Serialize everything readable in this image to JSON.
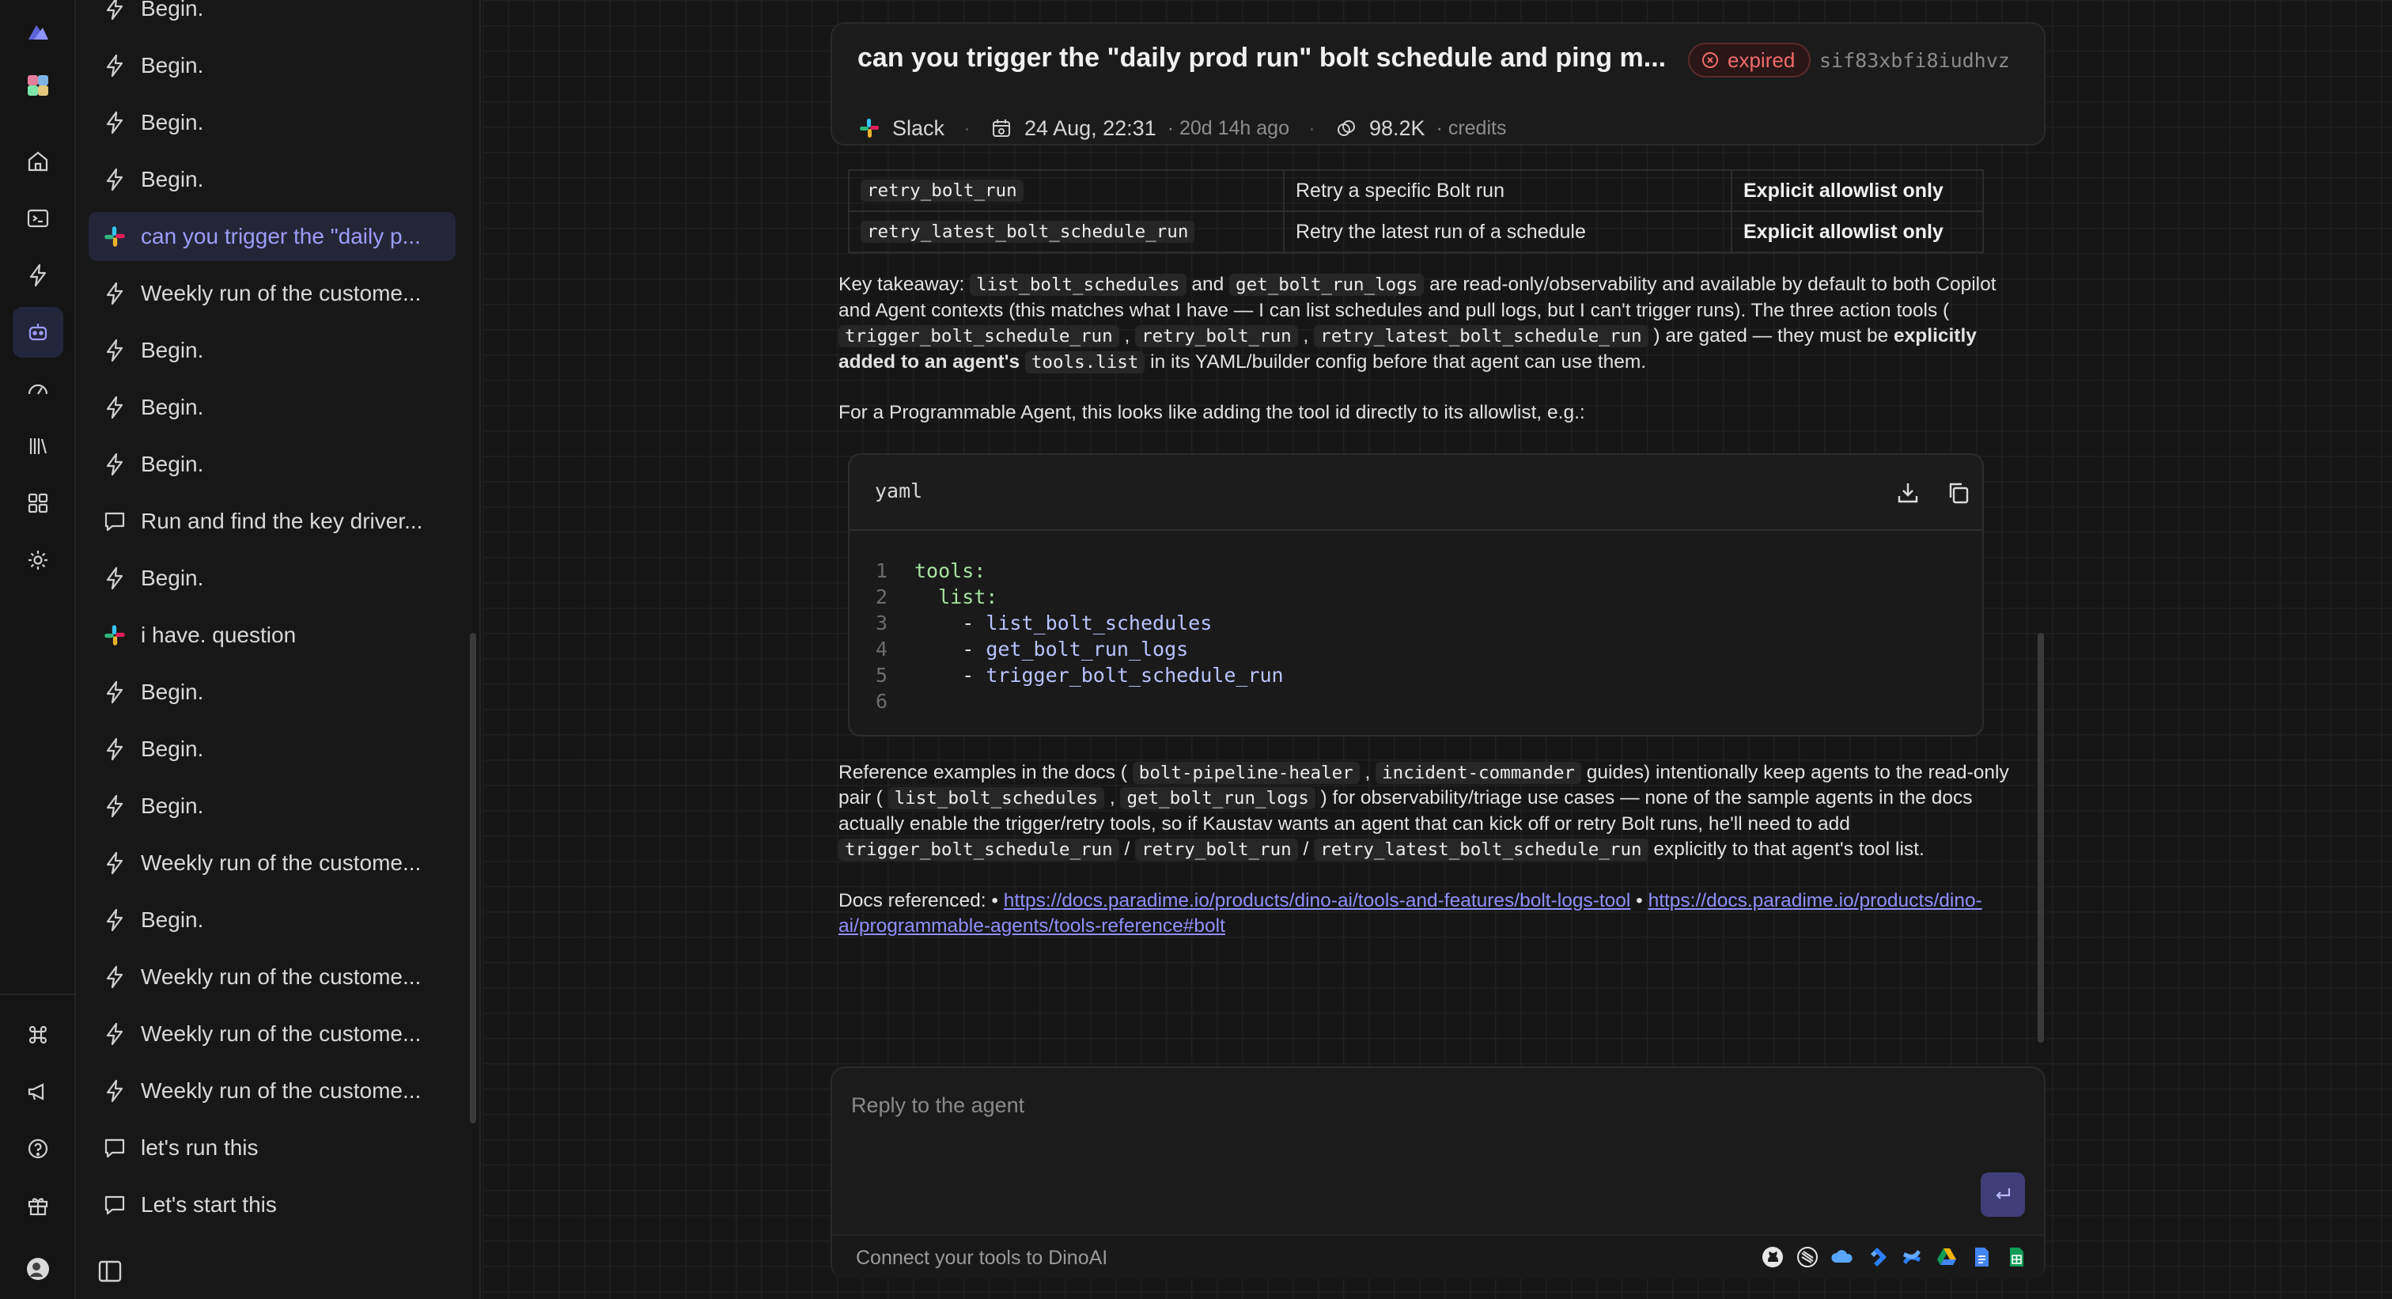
{
  "rail": {
    "top_icons": [
      "logo-icon",
      "workspace-icon",
      "home-icon",
      "terminal-icon",
      "bolt-icon",
      "bot-icon",
      "gauge-icon",
      "library-icon",
      "apps-icon",
      "settings-icon"
    ],
    "bottom_icons": [
      "command-icon",
      "megaphone-icon",
      "help-icon",
      "gift-icon",
      "avatar"
    ]
  },
  "sidebar": {
    "items": [
      {
        "icon": "bolt",
        "label": "Begin."
      },
      {
        "icon": "bolt",
        "label": "Begin."
      },
      {
        "icon": "bolt",
        "label": "Begin."
      },
      {
        "icon": "bolt",
        "label": "Begin."
      },
      {
        "icon": "slack",
        "label": "can you trigger the \"daily p...",
        "active": true
      },
      {
        "icon": "bolt",
        "label": "Weekly run of the custome..."
      },
      {
        "icon": "bolt",
        "label": "Begin."
      },
      {
        "icon": "bolt",
        "label": "Begin."
      },
      {
        "icon": "bolt",
        "label": "Begin."
      },
      {
        "icon": "chat",
        "label": "Run and find the key driver..."
      },
      {
        "icon": "bolt",
        "label": "Begin."
      },
      {
        "icon": "slack",
        "label": "i have. question"
      },
      {
        "icon": "bolt",
        "label": "Begin."
      },
      {
        "icon": "bolt",
        "label": "Begin."
      },
      {
        "icon": "bolt",
        "label": "Begin."
      },
      {
        "icon": "bolt",
        "label": "Weekly run of the custome..."
      },
      {
        "icon": "bolt",
        "label": "Begin."
      },
      {
        "icon": "bolt",
        "label": "Weekly run of the custome..."
      },
      {
        "icon": "bolt",
        "label": "Weekly run of the custome..."
      },
      {
        "icon": "bolt",
        "label": "Weekly run of the custome..."
      },
      {
        "icon": "chat",
        "label": "let's run this"
      },
      {
        "icon": "chat",
        "label": "Let's start this"
      }
    ]
  },
  "chat": {
    "title": "can you trigger the \"daily prod run\" bolt schedule and ping m...",
    "status": "expired",
    "id": "sif83xbfi8iudhvz",
    "source": "Slack",
    "date": "24 Aug, 22:31",
    "relative": "· 20d 14h ago",
    "credits_value": "98.2K",
    "credits_label": "· credits"
  },
  "message": {
    "table_rows": [
      {
        "tool": "retry_bolt_run",
        "desc": "Retry a specific Bolt run",
        "access": "Explicit allowlist only"
      },
      {
        "tool": "retry_latest_bolt_schedule_run",
        "desc": "Retry the latest run of a schedule",
        "access": "Explicit allowlist only"
      }
    ],
    "p1": {
      "t1": "Key takeaway: ",
      "c1": "list_bolt_schedules",
      "t2": " and ",
      "c2": "get_bolt_run_logs",
      "t3": " are read-only/observability and available by default to both Copilot and Agent contexts (this matches what I have — I can list schedules and pull logs, but I can't trigger runs). The three action tools ( ",
      "c3": "trigger_bolt_schedule_run",
      "t4": " , ",
      "c4": "retry_bolt_run",
      "t5": " , ",
      "c5": "retry_latest_bolt_schedule_run",
      "t6": " ) are gated — they must be ",
      "b1": "explicitly added to an agent's ",
      "c6": "tools.list",
      "t7": " in its YAML/builder config before that agent can use them."
    },
    "p2": "For a Programmable Agent, this looks like adding the tool id directly to its allowlist, e.g.:",
    "code": {
      "lang": "yaml",
      "lines": [
        {
          "n": "1",
          "key": "tools:",
          "dash": "",
          "val": ""
        },
        {
          "n": "2",
          "key": "  list:",
          "dash": "",
          "val": ""
        },
        {
          "n": "3",
          "key": "",
          "dash": "    - ",
          "val": "list_bolt_schedules"
        },
        {
          "n": "4",
          "key": "",
          "dash": "    - ",
          "val": "get_bolt_run_logs"
        },
        {
          "n": "5",
          "key": "",
          "dash": "    - ",
          "val": "trigger_bolt_schedule_run"
        },
        {
          "n": "6",
          "key": "",
          "dash": "",
          "val": ""
        }
      ]
    },
    "p3": {
      "t1": "Reference examples in the docs ( ",
      "c1": "bolt-pipeline-healer",
      "t2": " , ",
      "c2": "incident-commander",
      "t3": " guides) intentionally keep agents to the read-only pair ( ",
      "c3": "list_bolt_schedules",
      "t4": " , ",
      "c4": "get_bolt_run_logs",
      "t5": " ) for observability/triage use cases — none of the sample agents in the docs actually enable the trigger/retry tools, so if Kaustav wants an agent that can kick off or retry Bolt runs, he'll need to add ",
      "c5": "trigger_bolt_schedule_run",
      "t6": " / ",
      "c6": "retry_bolt_run",
      "t7": " / ",
      "c7": "retry_latest_bolt_schedule_run",
      "t8": " explicitly to that agent's tool list."
    },
    "docs": {
      "label": "Docs referenced: • ",
      "link1": "https://docs.paradime.io/products/dino-ai/tools-and-features/bolt-logs-tool",
      "sep": " • ",
      "link2": "https://docs.paradime.io/products/dino-ai/programmable-agents/tools-reference#bolt"
    }
  },
  "composer": {
    "placeholder": "Reply to the agent",
    "connect_text": "Connect your tools to DinoAI",
    "tool_icons": [
      "github-icon",
      "stripe-icon",
      "cloud-icon",
      "jira-icon",
      "confluence-icon",
      "google-drive-icon",
      "google-docs-icon",
      "google-sheets-icon"
    ]
  },
  "colors": {
    "accent": "#9c9dfa",
    "expired": "#ef6b6b",
    "link": "#8f8ffc",
    "send": "#3e3f78"
  }
}
